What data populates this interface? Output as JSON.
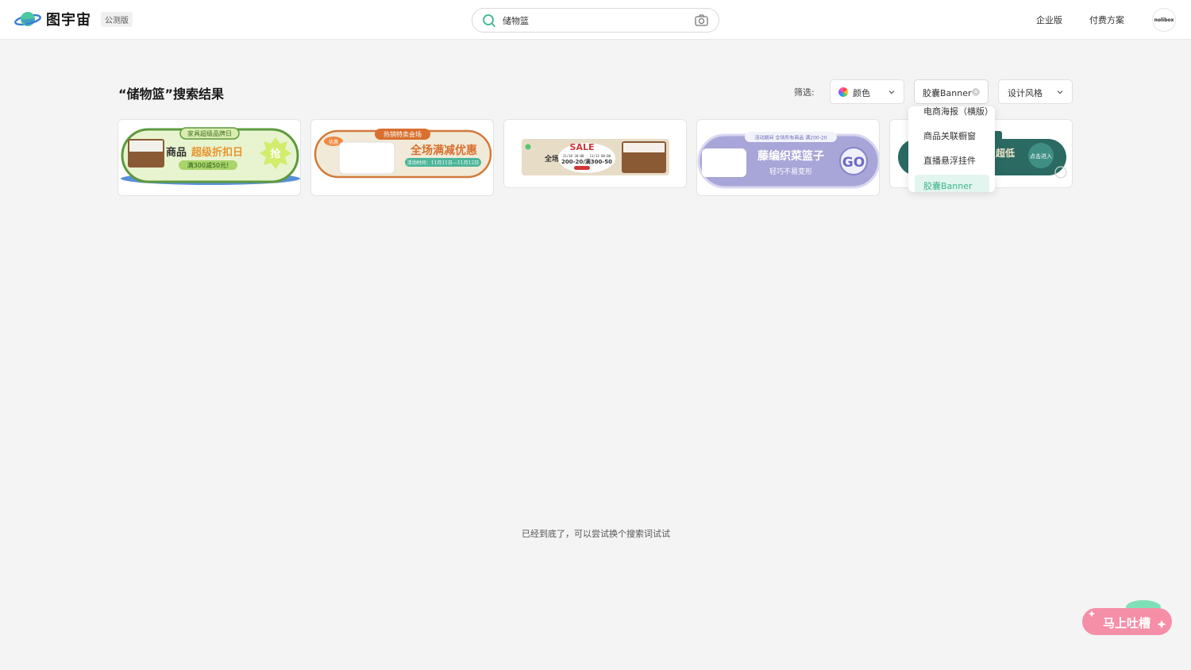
{
  "header": {
    "logo_text": "图宇宙",
    "beta_badge": "公测版",
    "search_value": "储物篮",
    "nav": [
      "企业版",
      "付费方案"
    ],
    "avatar_text": "nolibox"
  },
  "main": {
    "title": "“储物篮”搜索结果",
    "filter_label": "筛选:",
    "filters": {
      "color": "颜色",
      "type": "胶囊Banner",
      "style": "设计风格"
    },
    "dropdown": [
      "电商海报（横版）",
      "商品关联橱窗",
      "直播悬浮挂件",
      "胶囊Banner"
    ],
    "end_message": "已经到底了，可以尝试换个搜索词试试"
  },
  "cards": [
    {
      "top_tag": "家具超级品牌日",
      "title_a": "商品",
      "title_b": "超级折扣日",
      "sub": "满300减50元!",
      "badge": "抢"
    },
    {
      "top_tag": "热销特卖会场",
      "title": "全场满减优惠",
      "sub": "活动时间：11月11日—11月12日",
      "corner": "优惠"
    },
    {
      "title": "SALE",
      "line1": "11/10 20:00 - 11/13 00:00",
      "line2": "200-20/满300-50",
      "side": "全场"
    },
    {
      "top_tag": "活动期间 全场所有商品 满200-20",
      "title": "藤编织菜篮子",
      "sub": "轻巧不易变形",
      "badge": "GO"
    },
    {
      "title": "超低",
      "badge": "点击进入"
    }
  ],
  "feedback": {
    "label": "马上吐槽"
  },
  "colors": {
    "accent": "#3bb58e",
    "card1": "#e8f3cf",
    "card2": "#f1ead8",
    "card4": "#a8a5d8",
    "card5": "#2a6a62",
    "feedback": "#f58fa8"
  }
}
